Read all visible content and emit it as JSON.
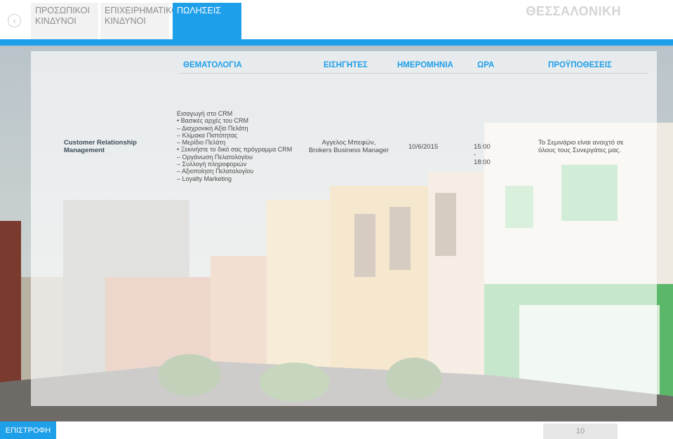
{
  "header": {
    "tabs": [
      {
        "line1": "ΠΡΟΣΩΠΙΚΟΙ",
        "line2": "ΚΙΝΔΥΝΟΙ"
      },
      {
        "line1": "ΕΠΙΧΕΙΡΗΜΑΤΙΚΟΙ",
        "line2": "ΚΙΝΔΥΝΟΙ"
      },
      {
        "line1": "ΠΩΛΗΣΕΙΣ",
        "line2": ""
      }
    ],
    "active_tab": 2,
    "city": "ΘΕΣΣΑΛΟΝΙΚΗ",
    "back_icon": "chevron-left-icon"
  },
  "table": {
    "columns": [
      "ΘΕΜΑΤΟΛΟΓΙΑ",
      "ΕΙΣΗΓΗΤΕΣ",
      "ΗΜΕΡΟΜΗΝΙΑ",
      "ΩΡΑ",
      "ΠΡΟΫΠΟΘΕΣΕΙΣ"
    ],
    "row": {
      "course_line1": "Customer Relationship",
      "course_line2": "Management",
      "agenda": [
        "Εισαγωγή στο CRM",
        "• Βασικές αρχές του CRM",
        "– Διαχρονική Αξία Πελάτη",
        "– Κλίμακα Πιστότητας",
        "– Μερίδιο Πελάτη",
        "• Ξεκινήστε το δικό σας πρόγραμμα CRM",
        "– Οργάνωση Πελατολογίου",
        "– Συλλογή πληροφοριών",
        "– Αξιοποίηση Πελατολογίου",
        "– Loyalty Marketing"
      ],
      "speaker_line1": "Αγγελος Μπεφών,",
      "speaker_line2": "Brokers Business Manager",
      "date": "10/6/2015",
      "time": "15:00 - 18:00",
      "prereq_line1": "Το Σεμινάριο είναι ανοιχτό σε",
      "prereq_line2": "όλους τους Συνεργάτες μας."
    }
  },
  "footer": {
    "return_label": "ΕΠΙΣΤΡΟΦΗ",
    "page_number": "10"
  },
  "colors": {
    "accent": "#1e9fe9",
    "panel_text": "#4a4a4a"
  }
}
